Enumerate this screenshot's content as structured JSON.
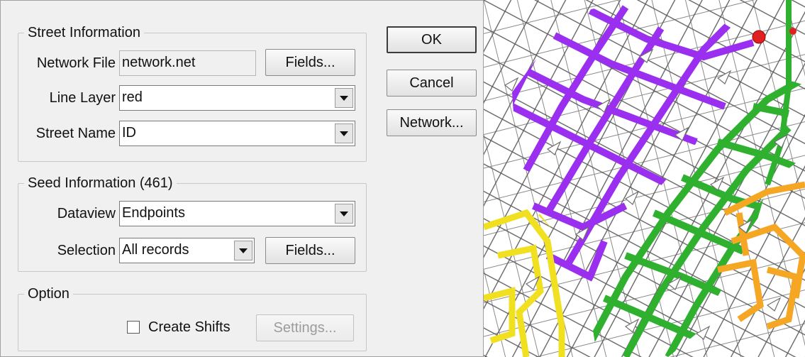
{
  "street_info": {
    "legend": "Street Information",
    "network_file_label": "Network File",
    "network_file_value": "network.net",
    "fields_button": "Fields...",
    "line_layer_label": "Line Layer",
    "line_layer_value": "red",
    "street_name_label": "Street Name",
    "street_name_value": "ID"
  },
  "seed_info": {
    "legend": "Seed Information (461)",
    "dataview_label": "Dataview",
    "dataview_value": "Endpoints",
    "selection_label": "Selection",
    "selection_value": "All records",
    "fields_button": "Fields..."
  },
  "option": {
    "legend": "Option",
    "create_shifts_label": "Create Shifts",
    "create_shifts_checked": false,
    "settings_button": "Settings..."
  },
  "buttons": {
    "ok": "OK",
    "cancel": "Cancel",
    "network": "Network..."
  },
  "map_colors": {
    "purple_route": "#9b2ff0",
    "green_route": "#2fb02f",
    "yellow_route": "#f0e020",
    "orange_route": "#f5a623",
    "red_marker": "#e02020",
    "arrows": "#6e6e6e"
  }
}
